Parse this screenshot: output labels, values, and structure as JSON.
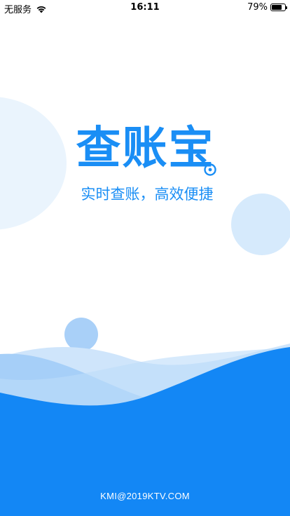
{
  "status_bar": {
    "carrier": "无服务",
    "time": "16:11",
    "battery_percent_label": "79%",
    "battery_level": 0.79
  },
  "splash": {
    "app_name": "查账宝",
    "slogan": "实时查账，高效便捷",
    "footer": "KMI@2019KTV.COM"
  },
  "colors": {
    "brand_blue": "#1a8ef5",
    "wave_dark": "#1387f5",
    "wave_mid": "#a6cff8",
    "wave_light": "#cfe5fb"
  },
  "icons": {
    "wifi": "wifi-icon",
    "battery": "battery-icon",
    "logo_badge": "coin-badge-icon"
  }
}
